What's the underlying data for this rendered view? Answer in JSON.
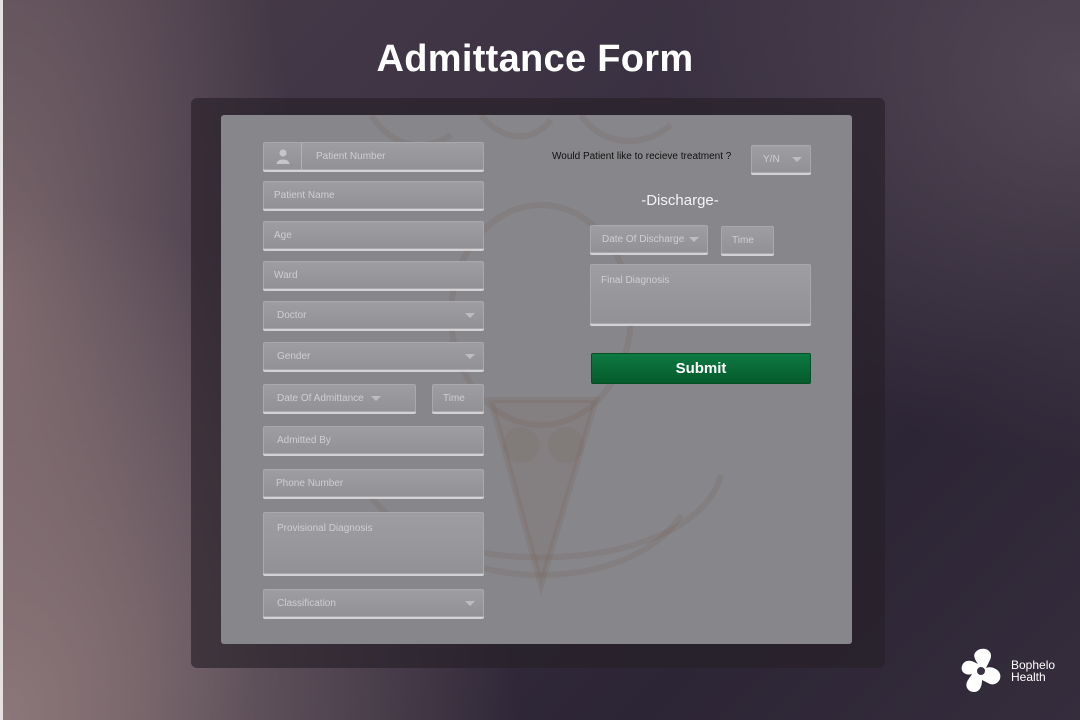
{
  "page": {
    "title": "Admittance Form"
  },
  "form": {
    "patient_number": {
      "placeholder": "Patient Number",
      "icon": "user-icon"
    },
    "patient_name": {
      "placeholder": "Patient Name"
    },
    "age": {
      "placeholder": "Age"
    },
    "ward": {
      "placeholder": "Ward"
    },
    "doctor": {
      "placeholder": "Doctor"
    },
    "gender": {
      "placeholder": "Gender"
    },
    "date_of_admittance": {
      "placeholder": "Date Of Admittance"
    },
    "admittance_time": {
      "placeholder": "Time"
    },
    "admitted_by": {
      "placeholder": "Admitted By"
    },
    "phone_number": {
      "placeholder": "Phone Number"
    },
    "provisional_diagnosis": {
      "placeholder": "Provisional Diagnosis"
    },
    "classification": {
      "placeholder": "Classification"
    }
  },
  "treatment": {
    "question": "Would Patient like to recieve treatment ?",
    "select_value": "Y/N"
  },
  "discharge": {
    "heading": "-Discharge-",
    "date": {
      "placeholder": "Date Of Discharge"
    },
    "time": {
      "placeholder": "Time"
    },
    "final_diagnosis": {
      "placeholder": "Final Diagnosis"
    }
  },
  "submit": {
    "label": "Submit",
    "color": "#06733c"
  },
  "brand": {
    "line1": "Bophelo",
    "line2": "Health"
  }
}
